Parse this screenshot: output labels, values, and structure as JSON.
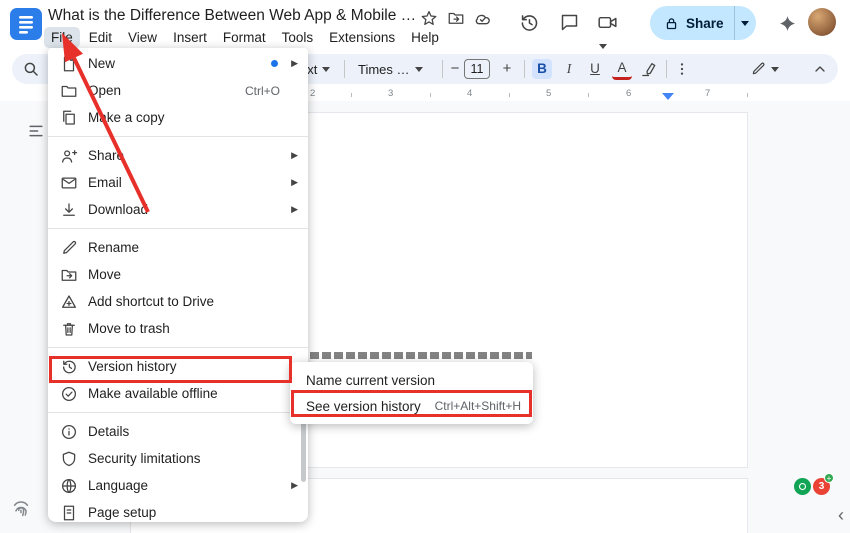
{
  "titlebar": {
    "title": "What is the Difference Between Web App & Mobile …",
    "menus": [
      "File",
      "Edit",
      "View",
      "Insert",
      "Format",
      "Tools",
      "Extensions",
      "Help"
    ],
    "share_label": "Share"
  },
  "toolbar": {
    "styles_label": "ext",
    "font_family_label": "Times …",
    "font_size_value": "11",
    "bold_label": "B",
    "italic_label": "I",
    "underline_label": "U",
    "text_color_label": "A"
  },
  "ruler": {
    "marks": [
      "2",
      "3",
      "4",
      "5",
      "6",
      "7"
    ]
  },
  "file_menu": {
    "items": [
      {
        "label": "New"
      },
      {
        "label": "Open",
        "shortcut": "Ctrl+O"
      },
      {
        "label": "Make a copy"
      },
      {
        "label": "Share"
      },
      {
        "label": "Email"
      },
      {
        "label": "Download"
      },
      {
        "label": "Rename"
      },
      {
        "label": "Move"
      },
      {
        "label": "Add shortcut to Drive"
      },
      {
        "label": "Move to trash"
      },
      {
        "label": "Version history"
      },
      {
        "label": "Make available offline"
      },
      {
        "label": "Details"
      },
      {
        "label": "Security limitations"
      },
      {
        "label": "Language"
      },
      {
        "label": "Page setup"
      }
    ]
  },
  "version_history_submenu": {
    "items": [
      {
        "label": "Name current version",
        "shortcut": ""
      },
      {
        "label": "See version history",
        "shortcut": "Ctrl+Alt+Shift+H"
      }
    ]
  },
  "badges": {
    "extension_count": "3",
    "extension_plus": "+"
  },
  "colors": {
    "annotation_red": "#e8302a",
    "share_pill": "#c2e7ff",
    "brand_blue": "#1a73e8"
  }
}
